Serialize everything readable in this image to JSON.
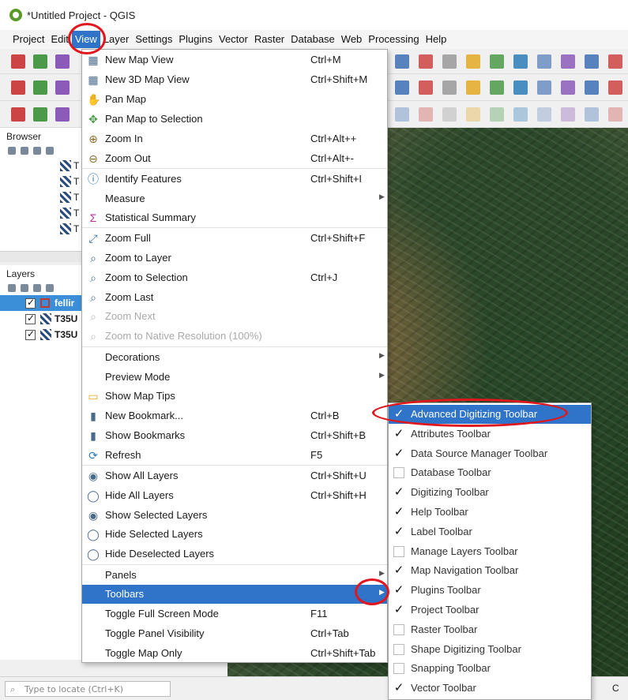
{
  "window": {
    "title": "*Untitled Project - QGIS"
  },
  "menubar": {
    "items": [
      "Project",
      "Edit",
      "View",
      "Layer",
      "Settings",
      "Plugins",
      "Vector",
      "Raster",
      "Database",
      "Web",
      "Processing",
      "Help"
    ],
    "active": "View"
  },
  "browser": {
    "title": "Browser",
    "item_prefix": "T"
  },
  "layers": {
    "title": "Layers",
    "rows": [
      {
        "label": "fellir",
        "checked": true,
        "selected": true
      },
      {
        "label": "T35U",
        "checked": true,
        "selected": false
      },
      {
        "label": "T35U",
        "checked": true,
        "selected": false
      }
    ]
  },
  "view_menu": {
    "items": [
      {
        "label": "New Map View",
        "shortcut": "Ctrl+M",
        "icon": "new-map-view-icon"
      },
      {
        "label": "New 3D Map View",
        "shortcut": "Ctrl+Shift+M",
        "icon": "new-3d-map-view-icon"
      },
      {
        "label": "Pan Map",
        "shortcut": "",
        "icon": "pan-hand-icon"
      },
      {
        "label": "Pan Map to Selection",
        "shortcut": "",
        "icon": "pan-to-selection-icon"
      },
      {
        "label": "Zoom In",
        "shortcut": "Ctrl+Alt++",
        "icon": "zoom-in-icon"
      },
      {
        "label": "Zoom Out",
        "shortcut": "Ctrl+Alt+-",
        "icon": "zoom-out-icon"
      },
      {
        "label": "Identify Features",
        "shortcut": "Ctrl+Shift+I",
        "icon": "identify-icon"
      },
      {
        "label": "Measure",
        "shortcut": "",
        "icon": "",
        "submenu": true
      },
      {
        "label": "Statistical Summary",
        "shortcut": "",
        "icon": "sigma-icon"
      },
      {
        "label": "Zoom Full",
        "shortcut": "Ctrl+Shift+F",
        "icon": "zoom-full-icon"
      },
      {
        "label": "Zoom to Layer",
        "shortcut": "",
        "icon": "zoom-to-layer-icon"
      },
      {
        "label": "Zoom to Selection",
        "shortcut": "Ctrl+J",
        "icon": "zoom-to-selection-icon"
      },
      {
        "label": "Zoom Last",
        "shortcut": "",
        "icon": "zoom-last-icon"
      },
      {
        "label": "Zoom Next",
        "shortcut": "",
        "icon": "zoom-next-icon",
        "disabled": true
      },
      {
        "label": "Zoom to Native Resolution (100%)",
        "shortcut": "",
        "icon": "zoom-native-icon",
        "disabled": true
      },
      {
        "label": "Decorations",
        "shortcut": "",
        "icon": "",
        "submenu": true
      },
      {
        "label": "Preview Mode",
        "shortcut": "",
        "icon": "",
        "submenu": true
      },
      {
        "label": "Show Map Tips",
        "shortcut": "",
        "icon": "map-tips-icon"
      },
      {
        "label": "New Bookmark...",
        "shortcut": "Ctrl+B",
        "icon": "new-bookmark-icon"
      },
      {
        "label": "Show Bookmarks",
        "shortcut": "Ctrl+Shift+B",
        "icon": "show-bookmarks-icon"
      },
      {
        "label": "Refresh",
        "shortcut": "F5",
        "icon": "refresh-icon"
      },
      {
        "label": "Show All Layers",
        "shortcut": "Ctrl+Shift+U",
        "icon": "show-all-layers-icon"
      },
      {
        "label": "Hide All Layers",
        "shortcut": "Ctrl+Shift+H",
        "icon": "hide-all-layers-icon"
      },
      {
        "label": "Show Selected Layers",
        "shortcut": "",
        "icon": "show-selected-layers-icon"
      },
      {
        "label": "Hide Selected Layers",
        "shortcut": "",
        "icon": "hide-selected-layers-icon"
      },
      {
        "label": "Hide Deselected Layers",
        "shortcut": "",
        "icon": "hide-deselected-layers-icon"
      },
      {
        "label": "Panels",
        "shortcut": "",
        "icon": "",
        "submenu": true
      },
      {
        "label": "Toolbars",
        "shortcut": "",
        "icon": "",
        "submenu": true,
        "highlight": true
      },
      {
        "label": "Toggle Full Screen Mode",
        "shortcut": "F11",
        "icon": ""
      },
      {
        "label": "Toggle Panel Visibility",
        "shortcut": "Ctrl+Tab",
        "icon": ""
      },
      {
        "label": "Toggle Map Only",
        "shortcut": "Ctrl+Shift+Tab",
        "icon": ""
      }
    ]
  },
  "toolbars_submenu": {
    "items": [
      {
        "label": "Advanced Digitizing Toolbar",
        "checked": true,
        "highlight": true
      },
      {
        "label": "Attributes Toolbar",
        "checked": true
      },
      {
        "label": "Data Source Manager Toolbar",
        "checked": true
      },
      {
        "label": "Database Toolbar",
        "checked": false
      },
      {
        "label": "Digitizing Toolbar",
        "checked": true
      },
      {
        "label": "Help Toolbar",
        "checked": true
      },
      {
        "label": "Label Toolbar",
        "checked": true
      },
      {
        "label": "Manage Layers Toolbar",
        "checked": false
      },
      {
        "label": "Map Navigation Toolbar",
        "checked": true
      },
      {
        "label": "Plugins Toolbar",
        "checked": true
      },
      {
        "label": "Project Toolbar",
        "checked": true
      },
      {
        "label": "Raster Toolbar",
        "checked": false
      },
      {
        "label": "Shape Digitizing Toolbar",
        "checked": false
      },
      {
        "label": "Snapping Toolbar",
        "checked": false
      },
      {
        "label": "Vector Toolbar",
        "checked": true
      }
    ]
  },
  "statusbar": {
    "locator_placeholder": "Type to locate (Ctrl+K)",
    "right_text": "C"
  },
  "colors": {
    "highlight": "#2f74c8",
    "annotation": "#e0171c",
    "selected_layer": "#3b8ed8"
  }
}
